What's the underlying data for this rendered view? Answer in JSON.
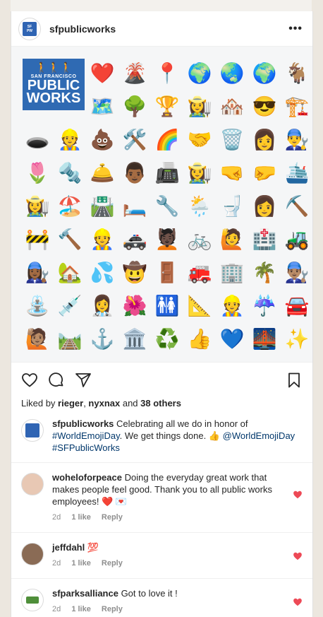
{
  "post": {
    "username": "sfpublicworks",
    "more_label": "•••",
    "logo": {
      "line1": "SAN FRANCISCO",
      "line2": "PUBLIC",
      "line3": "WORKS"
    },
    "emojis": [
      "❤️",
      "🌋",
      "📍",
      "🌍",
      "🌏",
      "🌍",
      "🐐",
      "🗺️",
      "🌳",
      "🏆",
      "👩‍🌾",
      "🏘️",
      "😎",
      "🏗️",
      "🕳️",
      "👷",
      "💩",
      "🛠️",
      "🌈",
      "🤝",
      "🗑️",
      "👩",
      "👨‍🔧",
      "🌷",
      "🔩",
      "🛎️",
      "👨🏾",
      "📠",
      "👩‍🌾",
      "🤜",
      "🤛",
      "🛳️",
      "👩‍🌾",
      "🏖️",
      "🛣️",
      "🛏️",
      "🔧",
      "🌦️",
      "🚽",
      "👩",
      "⛏️",
      "🚧",
      "🔨",
      "👷",
      "🚓",
      "💆🏿",
      "🚲",
      "🙋",
      "🏥",
      "🚜",
      "👩🏾‍🔧",
      "🏡",
      "💦",
      "🤠",
      "🚪",
      "🚒",
      "🏢",
      "🌴",
      "👨🏽‍🔧",
      "⛲",
      "💉",
      "👩‍⚕️",
      "🌺",
      "🚻",
      "📐",
      "👷",
      "☔",
      "🚘",
      "🙋🏽",
      "🛤️",
      "⚓",
      "🏛️",
      "♻️",
      "👍",
      "💙",
      "🌉",
      "✨"
    ],
    "likes": {
      "prefix": "Liked by ",
      "user1": "rieger",
      "sep": ", ",
      "user2": "nyxnax",
      "and": " and ",
      "others": "38 others"
    },
    "caption": {
      "username": "sfpublicworks",
      "text": " Celebrating all we do in honor of ",
      "tag1": "#WorldEmojiDay",
      "text2": ". We get things done. 👍 ",
      "mention": "@WorldEmojiDay",
      "tag2": "#SFPublicWorks"
    },
    "comments": [
      {
        "username": "woheloforpeace",
        "text": " Doing the everyday great work that makes people feel good. Thank you to all public works employees! ❤️ 💌",
        "age": "2d",
        "likes": "1 like",
        "reply": "Reply",
        "avatar_icon": "baby-photo"
      },
      {
        "username": "jeffdahl",
        "text": " 💯",
        "age": "2d",
        "likes": "1 like",
        "reply": "Reply",
        "avatar_icon": "man-photo"
      },
      {
        "username": "sfparksalliance",
        "text": " Got to love it !",
        "age": "2d",
        "likes": "1 like",
        "reply": "Reply",
        "avatar_icon": "parks-logo"
      }
    ],
    "colors": {
      "heart": "#ed4956",
      "link": "#00376b",
      "brand_blue": "#2f6ab3"
    }
  }
}
